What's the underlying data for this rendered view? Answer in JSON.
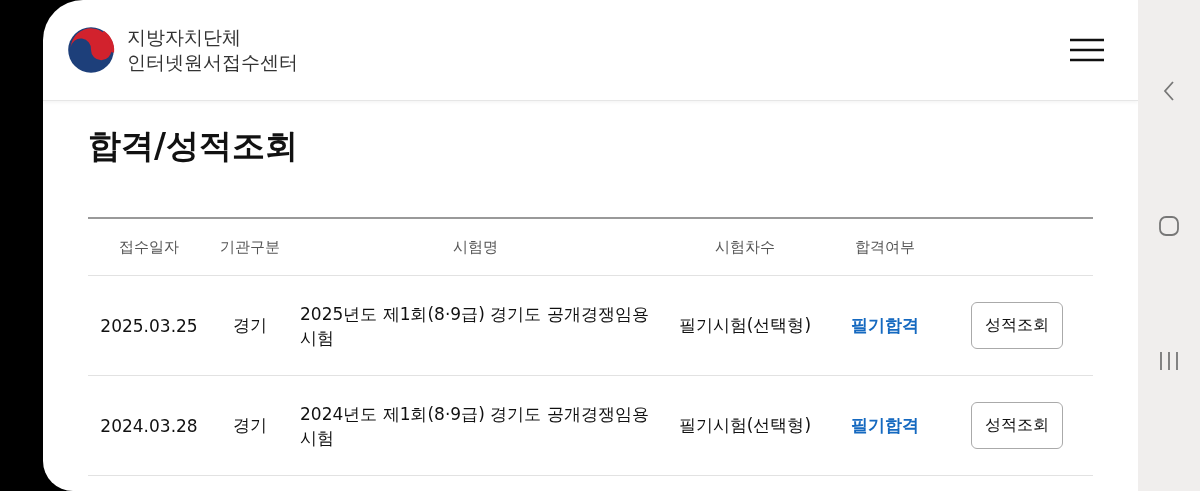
{
  "header": {
    "site_name_line1": "지방자치단체",
    "site_name_line2": "인터넷원서접수센터"
  },
  "page_title": "합격/성적조회",
  "table": {
    "columns": [
      "접수일자",
      "기관구분",
      "시험명",
      "시험차수",
      "합격여부"
    ],
    "rows": [
      {
        "date": "2025.03.25",
        "agency": "경기",
        "exam_name": "2025년도 제1회(8·9급) 경기도 공개경쟁임용 시험",
        "round": "필기시험(선택형)",
        "result": "필기합격",
        "action": "성적조회"
      },
      {
        "date": "2024.03.28",
        "agency": "경기",
        "exam_name": "2024년도 제1회(8·9급) 경기도 공개경쟁임용 시험",
        "round": "필기시험(선택형)",
        "result": "필기합격",
        "action": "성적조회"
      }
    ]
  }
}
